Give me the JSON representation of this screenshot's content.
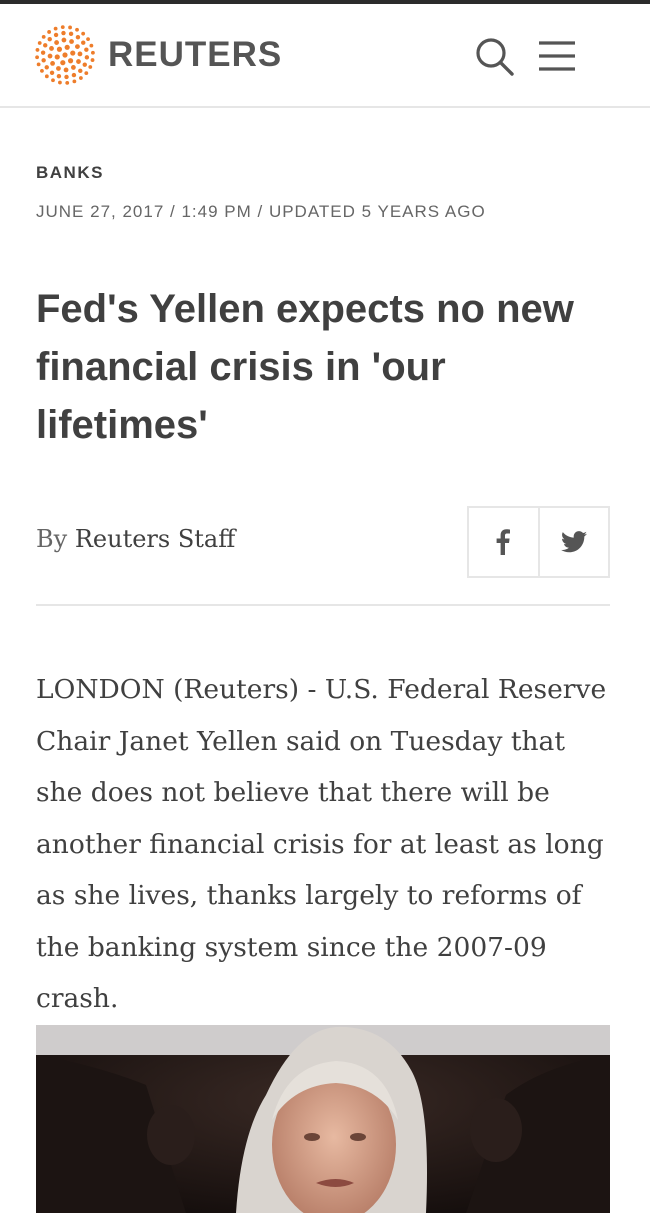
{
  "header": {
    "brand": "REUTERS",
    "search_icon": "search-icon",
    "menu_icon": "hamburger-menu-icon",
    "brand_color": "#ee7d2b"
  },
  "article": {
    "category": "BANKS",
    "dateline": "JUNE 27, 2017 / 1:49 PM / UPDATED 5 YEARS AGO",
    "headline": "Fed's Yellen expects no new financial crisis in 'our lifetimes'",
    "byline_prefix": "By",
    "byline_author": "Reuters Staff",
    "share": {
      "facebook_icon": "facebook-icon",
      "twitter_icon": "twitter-icon"
    },
    "lead": "LONDON (Reuters) - U.S. Federal Reserve Chair Janet Yellen said on Tuesday that she does not believe that there will be another financial crisis for at least as long as she lives, thanks largely to reforms of the banking system since the 2007-09 crash."
  }
}
